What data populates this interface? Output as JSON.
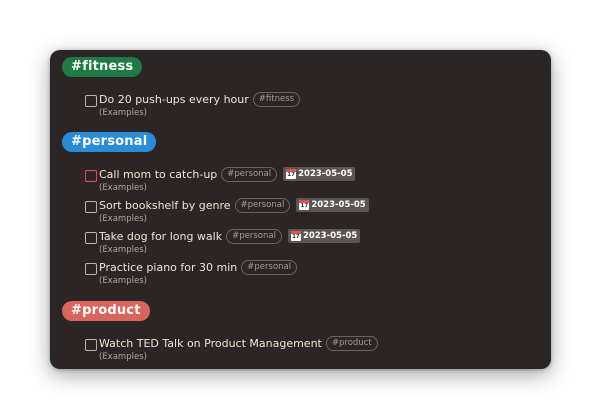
{
  "groups": [
    {
      "tag": "#fitness",
      "color": "#1f7a45",
      "tasks": [
        {
          "text": "Do 20 push-ups every hour",
          "tag": "#fitness",
          "source": "(Examples)"
        }
      ]
    },
    {
      "tag": "#personal",
      "color": "#2a8bd6",
      "tasks": [
        {
          "text": "Call mom to catch-up",
          "tag": "#personal",
          "date": "2023-05-05",
          "source": "(Examples)"
        },
        {
          "text": "Sort bookshelf by genre",
          "tag": "#personal",
          "date": "2023-05-05",
          "source": "(Examples)"
        },
        {
          "text": "Take dog for long walk",
          "tag": "#personal",
          "date": "2023-05-05",
          "source": "(Examples)"
        },
        {
          "text": "Practice piano for 30 min",
          "tag": "#personal",
          "source": "(Examples)"
        }
      ]
    },
    {
      "tag": "#product",
      "color": "#d9665c",
      "tasks": [
        {
          "text": "Watch TED Talk on Product Management",
          "tag": "#product",
          "source": "(Examples)"
        }
      ]
    }
  ]
}
